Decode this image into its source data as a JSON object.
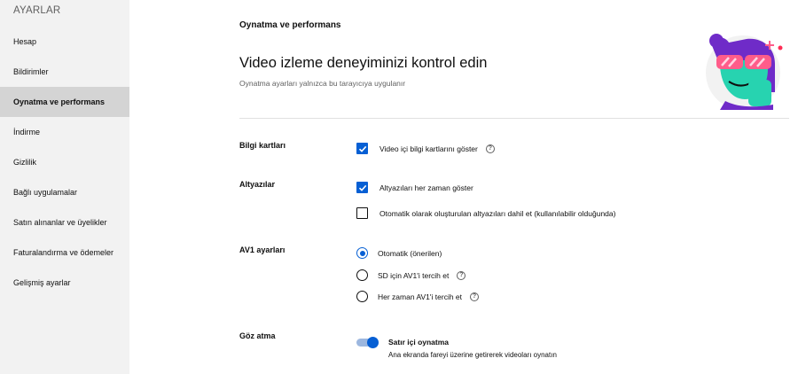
{
  "sidebar": {
    "title": "AYARLAR",
    "items": [
      {
        "label": "Hesap"
      },
      {
        "label": "Bildirimler"
      },
      {
        "label": "Oynatma ve performans"
      },
      {
        "label": "İndirme"
      },
      {
        "label": "Gizlilik"
      },
      {
        "label": "Bağlı uygulamalar"
      },
      {
        "label": "Satın alınanlar ve üyelikler"
      },
      {
        "label": "Faturalandırma ve ödemeler"
      },
      {
        "label": "Gelişmiş ayarlar"
      }
    ],
    "active_index": 2
  },
  "main": {
    "section_title": "Oynatma ve performans",
    "headline": "Video izleme deneyiminizi kontrol edin",
    "subtitle": "Oynatma ayarları yalnızca bu tarayıcıya uygulanır",
    "info_cards": {
      "label": "Bilgi kartları",
      "option": {
        "label": "Video içi bilgi kartlarını göster",
        "checked": true
      }
    },
    "captions": {
      "label": "Altyazılar",
      "options": [
        {
          "label": "Altyazıları her zaman göster",
          "checked": true
        },
        {
          "label": "Otomatik olarak oluşturulan altyazıları dahil et (kullanılabilir olduğunda)",
          "checked": false
        }
      ]
    },
    "av1": {
      "label": "AV1 ayarları",
      "options": [
        {
          "label": "Otomatik (önerilen)",
          "selected": true
        },
        {
          "label": "SD için AV1'i tercih et",
          "selected": false
        },
        {
          "label": "Her zaman AV1'i tercih et",
          "selected": false
        }
      ]
    },
    "glance": {
      "label": "Göz atma",
      "toggle_label": "Satır içi oynatma",
      "toggle_desc": "Ana ekranda fareyi üzerine getirerek videoları oynatın",
      "enabled": true
    },
    "help_icon": "?"
  },
  "colors": {
    "accent": "#065fd4",
    "sidebar_bg": "#f2f2f2",
    "sidebar_active": "#d4d4d4"
  },
  "icons": {
    "checkbox": "check-icon",
    "help": "help-circle-icon",
    "illustration": "sunglasses-character-illustration"
  }
}
